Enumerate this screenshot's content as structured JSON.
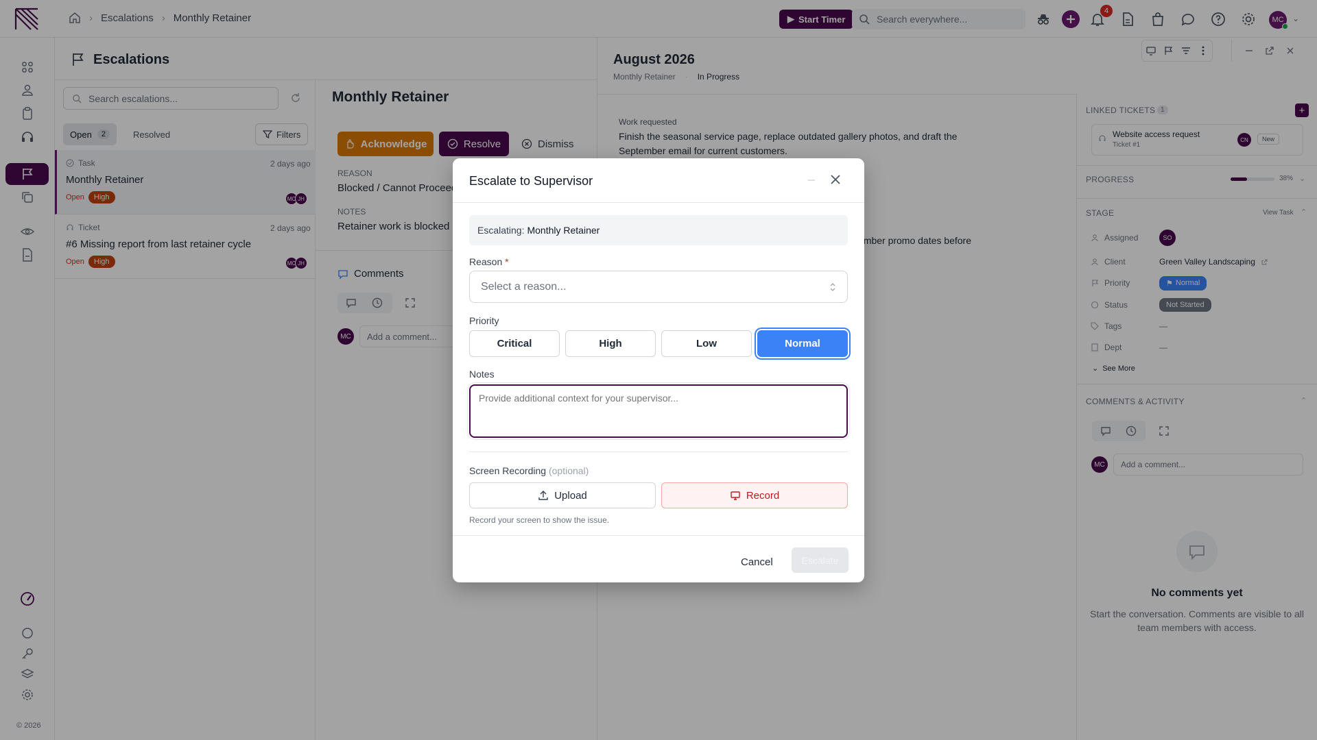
{
  "header": {
    "breadcrumbs": [
      "Escalations",
      "Monthly Retainer"
    ],
    "timer_label": "Start Timer",
    "search_placeholder": "Search everywhere...",
    "notification_count": "4",
    "user_initials": "MC"
  },
  "rail": {
    "copyright": "© 2026"
  },
  "list": {
    "title": "Escalations",
    "search_placeholder": "Search escalations...",
    "tabs": [
      {
        "label": "Open",
        "count": "2"
      },
      {
        "label": "Resolved"
      }
    ],
    "filters_label": "Filters",
    "items": [
      {
        "type": "Task",
        "title": "Monthly Retainer",
        "date": "2 days ago",
        "status": "Open",
        "priority": "High",
        "avatars": [
          "MC",
          "JH"
        ]
      },
      {
        "type": "Ticket",
        "title": "#6 Missing report from last retainer cycle",
        "date": "2 days ago",
        "status": "Open",
        "priority": "High",
        "avatars": [
          "MC",
          "JH"
        ]
      }
    ]
  },
  "detail": {
    "title": "Monthly Retainer",
    "actions": {
      "acknowledge": "Acknowledge",
      "resolve": "Resolve",
      "dismiss": "Dismiss"
    },
    "reason_label": "REASON",
    "reason_value": "Blocked / Cannot Proceed",
    "notes_label": "NOTES",
    "notes_value": "Retainer work is blocked o",
    "comments_title": "Comments",
    "comment_placeholder": "Add a comment...",
    "commenter_initials": "MC"
  },
  "task": {
    "title": "August 2026",
    "parent": "Monthly Retainer",
    "status": "In Progress",
    "work_label": "Work requested",
    "work_text": "Finish the seasonal service page, replace outdated gallery photos, and draft the September email for current customers.",
    "fragment_text": "ember promo dates before",
    "linked_title": "LINKED TICKETS",
    "linked_count": "1",
    "linked_ticket": {
      "title": "Website access request",
      "sub": "Ticket #1",
      "initials": "CN",
      "badge": "New"
    },
    "progress_label": "PROGRESS",
    "progress_value": 38,
    "progress_text": "38%",
    "stage_label": "STAGE",
    "view_task": "View Task",
    "props": [
      {
        "key": "Assigned",
        "value": "SO"
      },
      {
        "key": "Client",
        "value": "Green Valley Landscaping"
      },
      {
        "key": "Priority",
        "value": "Normal"
      },
      {
        "key": "Status",
        "value": "Not Started"
      },
      {
        "key": "Tags",
        "value": "—"
      },
      {
        "key": "Dept",
        "value": "—"
      }
    ],
    "see_more": "See More",
    "activity_title": "COMMENTS & ACTIVITY",
    "comment_placeholder": "Add a comment...",
    "empty_title": "No comments yet",
    "empty_text": "Start the conversation. Comments are visible to all team members with access."
  },
  "modal": {
    "title": "Escalate to Supervisor",
    "escalating_label": "Escalating:",
    "escalating_value": "Monthly Retainer",
    "reason_label": "Reason",
    "required_mark": "*",
    "reason_placeholder": "Select a reason...",
    "priority_label": "Priority",
    "priorities": [
      "Critical",
      "High",
      "Low",
      "Normal"
    ],
    "selected_priority": "Normal",
    "notes_label": "Notes",
    "notes_placeholder": "Provide additional context for your supervisor...",
    "recording_label": "Screen Recording",
    "recording_optional": "(optional)",
    "upload_label": "Upload",
    "record_label": "Record",
    "recording_hint": "Record your screen to show the issue.",
    "cancel_label": "Cancel",
    "escalate_label": "Escalate"
  },
  "colors": {
    "brand": "#4a0a4e",
    "accent_blue": "#3b82f6",
    "high": "#c2410c",
    "warning": "#d97706"
  }
}
